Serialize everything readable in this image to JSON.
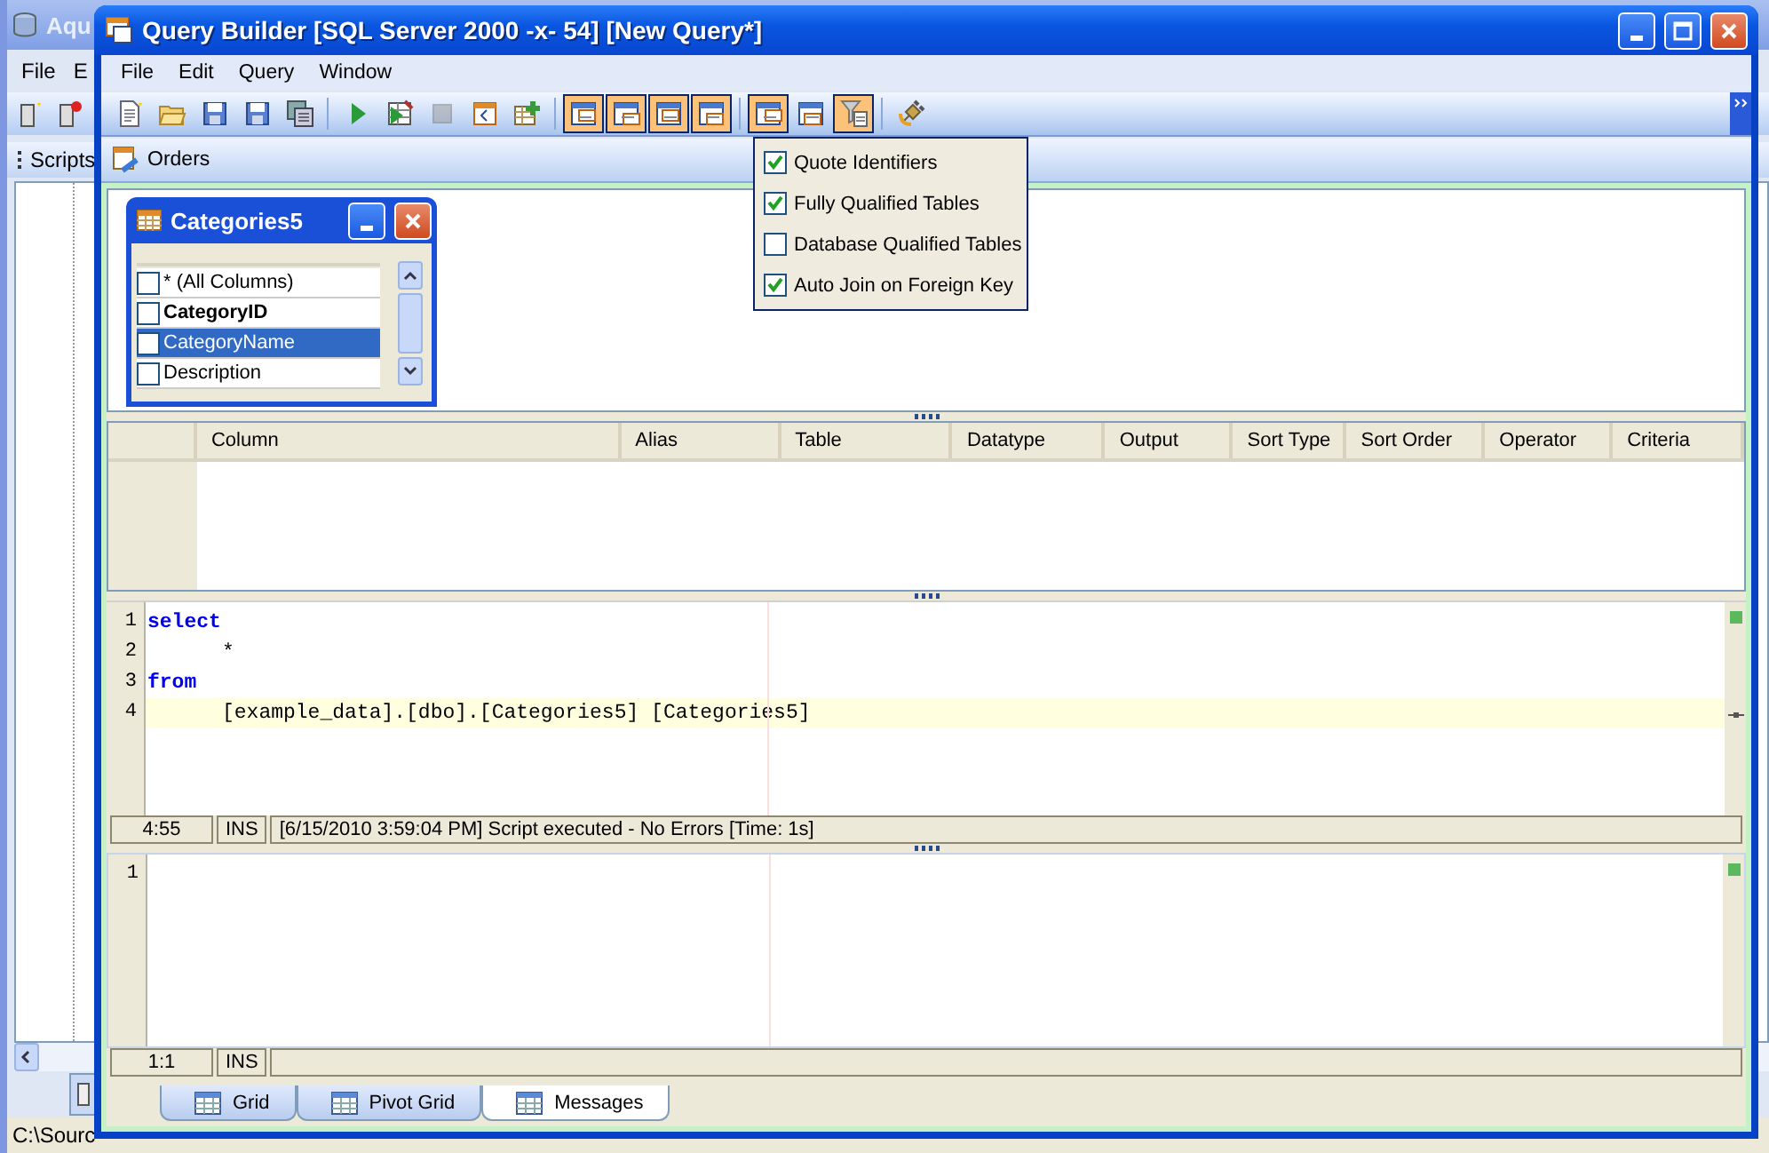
{
  "background_window": {
    "title": "Aqu",
    "menu": [
      "File",
      "E"
    ],
    "panel_title": "Scripts",
    "status_bar": "C:\\Sourc"
  },
  "window": {
    "title": "Query Builder [SQL Server 2000 -x- 54] [New Query*]"
  },
  "menu": [
    "File",
    "Edit",
    "Query",
    "Window"
  ],
  "toolbar": [
    {
      "kind": "button",
      "pressed": false,
      "disabled": false
    },
    {
      "kind": "button",
      "pressed": false,
      "disabled": false
    },
    {
      "kind": "button",
      "pressed": false,
      "disabled": false
    },
    {
      "kind": "button",
      "pressed": false,
      "disabled": false
    },
    {
      "kind": "button",
      "pressed": false,
      "disabled": false
    },
    {
      "kind": "separator"
    },
    {
      "kind": "button",
      "pressed": false,
      "disabled": false
    },
    {
      "kind": "button",
      "pressed": false,
      "disabled": false
    },
    {
      "kind": "button",
      "pressed": false,
      "disabled": true
    },
    {
      "kind": "button",
      "pressed": false,
      "disabled": false
    },
    {
      "kind": "button",
      "pressed": false,
      "disabled": false
    },
    {
      "kind": "separator"
    },
    {
      "kind": "button",
      "pressed": true,
      "disabled": false
    },
    {
      "kind": "button",
      "pressed": true,
      "disabled": false
    },
    {
      "kind": "button",
      "pressed": true,
      "disabled": false
    },
    {
      "kind": "button",
      "pressed": true,
      "disabled": false
    },
    {
      "kind": "separator"
    },
    {
      "kind": "button",
      "pressed": true,
      "disabled": false
    },
    {
      "kind": "button",
      "pressed": false,
      "disabled": false
    },
    {
      "kind": "button",
      "pressed": true,
      "disabled": false
    },
    {
      "kind": "separator"
    },
    {
      "kind": "button",
      "pressed": false,
      "disabled": false
    }
  ],
  "query_tabs": [
    {
      "label": "Orders",
      "selected": true
    }
  ],
  "options_menu": [
    {
      "label": "Quote Identifiers",
      "checked": true
    },
    {
      "label": "Fully Qualified Tables",
      "checked": true
    },
    {
      "label": "Database Qualified Tables",
      "checked": false
    },
    {
      "label": "Auto Join on Foreign Key",
      "checked": true
    }
  ],
  "table_window": {
    "title": "Categories5",
    "columns": [
      {
        "label": "* (All Columns)",
        "checked": false,
        "selected": false,
        "primary_key": false
      },
      {
        "label": "CategoryID",
        "checked": false,
        "selected": false,
        "primary_key": true
      },
      {
        "label": "CategoryName",
        "checked": false,
        "selected": true,
        "primary_key": false
      },
      {
        "label": "Description",
        "checked": false,
        "selected": false,
        "primary_key": false
      }
    ]
  },
  "grid": {
    "columns": [
      "Column",
      "Alias",
      "Table",
      "Datatype",
      "Output",
      "Sort Type",
      "Sort Order",
      "Operator",
      "Criteria"
    ]
  },
  "editor": {
    "lines": [
      {
        "number": "1",
        "text": "select",
        "kind": "keyword",
        "indented": false,
        "current": false
      },
      {
        "number": "2",
        "text": "*",
        "kind": "plain",
        "indented": true,
        "current": false
      },
      {
        "number": "3",
        "text": "from",
        "kind": "keyword",
        "indented": false,
        "current": false
      },
      {
        "number": "4",
        "text": "[example_data].[dbo].[Categories5] [Categories5]",
        "kind": "plain",
        "indented": true,
        "current": true
      }
    ],
    "status": {
      "position": "4:55",
      "mode": "INS",
      "message": "[6/15/2010 3:59:04 PM] Script executed - No Errors [Time: 1s]"
    }
  },
  "results": {
    "lines": [
      {
        "number": "1"
      }
    ],
    "status": {
      "position": "1:1",
      "mode": "INS"
    }
  },
  "result_tabs": [
    {
      "label": "Grid",
      "selected": false
    },
    {
      "label": "Pivot Grid",
      "selected": false
    },
    {
      "label": "Messages",
      "selected": true
    }
  ]
}
